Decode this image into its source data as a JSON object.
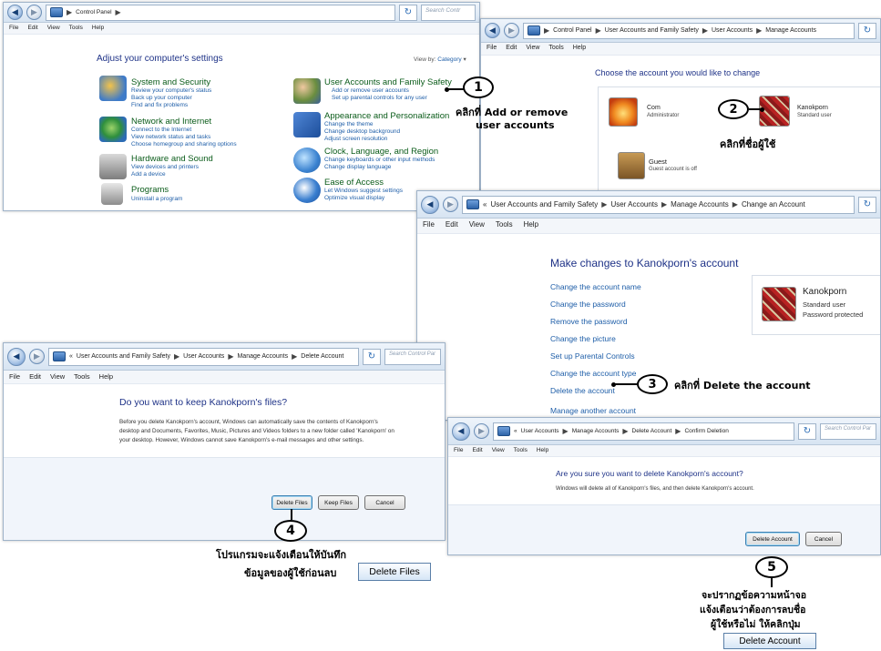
{
  "menu": {
    "file": "File",
    "edit": "Edit",
    "view": "View",
    "tools": "Tools",
    "help": "Help"
  },
  "w1": {
    "crumbs": [
      "Control Panel"
    ],
    "search_placeholder": "Search Contr",
    "heading": "Adjust your computer's settings",
    "view_by_label": "View by:",
    "view_by_value": "Category",
    "categories": [
      {
        "title": "System and Security",
        "links": [
          "Review your computer's status",
          "Back up your computer",
          "Find and fix problems"
        ]
      },
      {
        "title": "Network and Internet",
        "links": [
          "Connect to the Internet",
          "View network status and tasks",
          "Choose homegroup and sharing options"
        ]
      },
      {
        "title": "Hardware and Sound",
        "links": [
          "View devices and printers",
          "Add a device"
        ]
      },
      {
        "title": "Programs",
        "links": [
          "Uninstall a program"
        ]
      },
      {
        "title": "User Accounts and Family Safety",
        "links": [
          "Add or remove user accounts",
          "Set up parental controls for any user"
        ]
      },
      {
        "title": "Appearance and Personalization",
        "links": [
          "Change the theme",
          "Change desktop background",
          "Adjust screen resolution"
        ]
      },
      {
        "title": "Clock, Language, and Region",
        "links": [
          "Change keyboards or other input methods",
          "Change display language"
        ]
      },
      {
        "title": "Ease of Access",
        "links": [
          "Let Windows suggest settings",
          "Optimize visual display"
        ]
      }
    ]
  },
  "w2": {
    "crumbs": [
      "Control Panel",
      "User Accounts and Family Safety",
      "User Accounts",
      "Manage Accounts"
    ],
    "heading": "Choose the account you would like to change",
    "accounts": [
      {
        "name": "Com",
        "desc": "Administrator"
      },
      {
        "name": "Kanokporn",
        "desc": "Standard user"
      },
      {
        "name": "Guest",
        "desc": "Guest account is off"
      }
    ]
  },
  "w3": {
    "crumbs": [
      "User Accounts and Family Safety",
      "User Accounts",
      "Manage Accounts",
      "Change an Account"
    ],
    "heading": "Make changes to Kanokporn's account",
    "links": [
      "Change the account name",
      "Change the password",
      "Remove the password",
      "Change the picture",
      "Set up Parental Controls",
      "Change the account type",
      "Delete the account",
      "Manage another account"
    ],
    "account_name": "Kanokporn",
    "account_desc1": "Standard user",
    "account_desc2": "Password protected"
  },
  "w4": {
    "crumbs": [
      "User Accounts and Family Safety",
      "User Accounts",
      "Manage Accounts",
      "Delete Account"
    ],
    "search_placeholder": "Search Control Par",
    "heading": "Do you want to keep Kanokporn's files?",
    "body1": "Before you delete Kanokporn's account, Windows can automatically save the contents of Kanokporn's",
    "body2": "desktop and Documents, Favorites, Music, Pictures and Videos folders to a new folder called 'Kanokporn' on",
    "body3": "your desktop. However, Windows cannot save Kanokporn's e-mail messages and other settings.",
    "buttons": [
      "Delete Files",
      "Keep Files",
      "Cancel"
    ]
  },
  "w5": {
    "crumbs": [
      "User Accounts",
      "Manage Accounts",
      "Delete Account",
      "Confirm Deletion"
    ],
    "search_placeholder": "Search Control Par",
    "heading": "Are you sure you want to delete Kanokporn's account?",
    "body": "Windows will delete all of Kanokporn's files, and then delete Kanokporn's account.",
    "buttons": [
      "Delete Account",
      "Cancel"
    ]
  },
  "callouts": {
    "c1": {
      "num": "1",
      "line1": "คลิกที่ Add or remove",
      "line2": "user accounts"
    },
    "c2": {
      "num": "2",
      "text": "คลิกที่ชื่อผู้ใช้"
    },
    "c3": {
      "num": "3",
      "text": "คลิกที่ Delete the account"
    },
    "c4": {
      "num": "4",
      "line1": "โปรแกรมจะแจ้งเตือนให้บันทึก",
      "line2": "ข้อมูลของผู้ใช้ก่อนลบ",
      "button": "Delete Files"
    },
    "c5": {
      "num": "5",
      "line1": "จะปรากฏข้อความหน้าจอ",
      "line2": "แจ้งเตือนว่าต้องการลบชื่อ",
      "line3": "ผู้ใช้หรือไม่ ให้คลิกปุ่ม",
      "button": "Delete Account"
    }
  },
  "colors": {
    "link": "#1e5ea8",
    "heading": "#1e3287",
    "category_title": "#0b5c1a",
    "chrome": "#d7e4f2"
  }
}
